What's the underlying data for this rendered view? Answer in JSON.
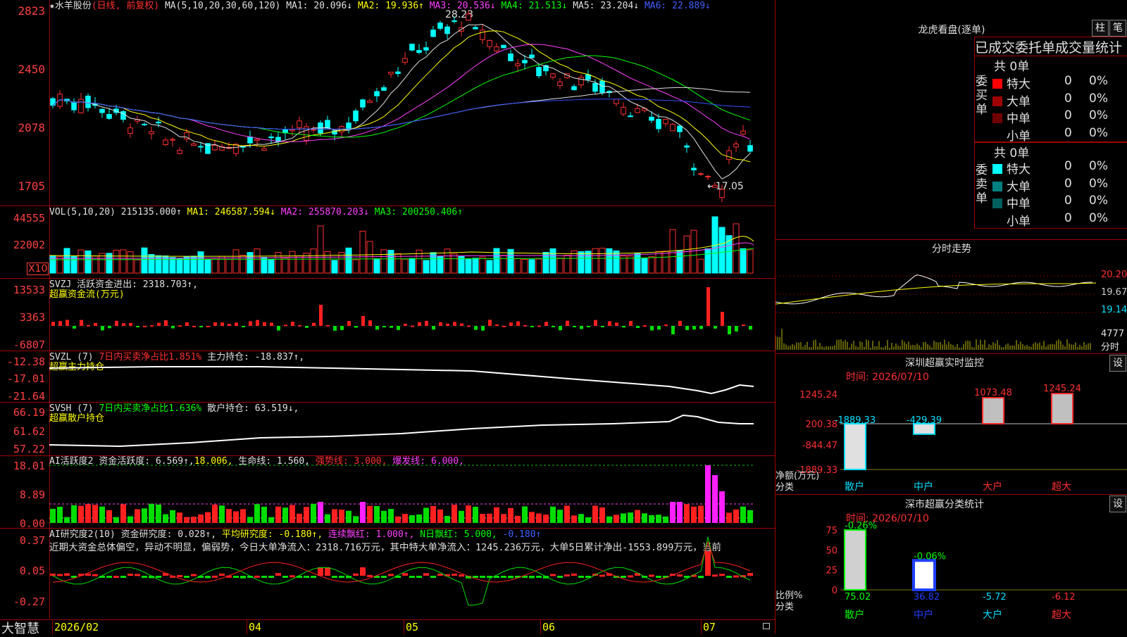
{
  "stock": {
    "star": "★",
    "name": "水羊股份",
    "mode": "(日线, 前复权)"
  },
  "main": {
    "ma_label": "MA(5,10,20,30,60,120)",
    "ma1": "MA1: 20.096↓",
    "ma2": "MA2: 19.936↑",
    "ma3": "MA3: 20.536↓",
    "ma4": "MA4: 21.513↓",
    "ma5": "MA5: 23.204↓",
    "ma6": "MA6: 22.889↓",
    "y_ticks": [
      "2823",
      "2450",
      "2078",
      "1705"
    ],
    "high_label": "28.23",
    "low_label": "←17.05"
  },
  "vol": {
    "label": "VOL(5,10,20)",
    "v": "215135.000↑",
    "ma1": "MA1: 246587.594↓",
    "ma2": "MA2: 255870.203↓",
    "ma3": "MA3: 200250.406↑",
    "y_ticks": [
      "44555",
      "22002"
    ],
    "unit": "X10"
  },
  "svzj": {
    "label1": "SVZJ  活跃资金进出: 2318.703↑,",
    "label2": "超赢资金流(万元)",
    "y_ticks": [
      "13533",
      "3363",
      "-6807"
    ]
  },
  "svzl": {
    "label1a": "SVZL (7)",
    "label1b": "7日内买卖净占比1.851%",
    "label1c": "主力持仓: -18.837↑,",
    "label2": "超赢主力持仓",
    "y_ticks": [
      "-12.38",
      "-17.01",
      "-21.64"
    ]
  },
  "svsh": {
    "label1a": "SVSH (7)",
    "label1b": "7日内买卖净占比1.636%",
    "label1c": "散户持仓: 63.519↓,",
    "label2": "超赢散户持仓",
    "y_ticks": [
      "66.19",
      "61.62",
      "57.22"
    ]
  },
  "ai2": {
    "a": "AI活跃度2",
    "b": "资金活跃度: 6.569↑,",
    "c": "18.006,",
    "d": "生命线: 1.560,",
    "e": "强势线: 3.000,",
    "f": "爆发线: 6.000,",
    "y_ticks": [
      "18.01",
      "8.89",
      "0.00"
    ]
  },
  "ai_r": {
    "a": "AI研究度2(10)",
    "b": "资金研究度: 0.028↑,",
    "c": "平均研究度: -0.180↑,",
    "d": "连续飘红: 1.000↑,",
    "e": "N日飘红: 5.000,",
    "f": "-0.180↑",
    "text": "近期大资金总体偏空，异动不明显，偏弱势，今日大单净流入：2318.716万元，其中特大单净流入：1245.236万元，大单5日累计净出-1553.899万元，当前",
    "y_ticks": [
      "0.37",
      "0.05",
      "-0.27"
    ]
  },
  "dates": [
    "2026/02",
    "04",
    "05",
    "06",
    "07"
  ],
  "brand": "大智慧",
  "right": {
    "lhb_title": "龙虎看盘(逐单)",
    "btn_zhu": "柱",
    "btn_bi": "笔",
    "headers": [
      "已成交",
      "委托单",
      "成交量统计"
    ],
    "buy_side": "委买单",
    "sell_side": "委卖单",
    "buy_total": "共 0单",
    "sell_total": "共 0单",
    "buy_rows": [
      {
        "label": "特大",
        "n": "0",
        "p": "0%",
        "color": "#ff0000"
      },
      {
        "label": "大单",
        "n": "0",
        "p": "0%",
        "color": "#a00000"
      },
      {
        "label": "中单",
        "n": "0",
        "p": "0%",
        "color": "#700000"
      },
      {
        "label": "小单",
        "n": "0",
        "p": "0%",
        "color": ""
      }
    ],
    "sell_rows": [
      {
        "label": "特大",
        "n": "0",
        "p": "0%",
        "color": "#00ffff"
      },
      {
        "label": "大单",
        "n": "0",
        "p": "0%",
        "color": "#008080"
      },
      {
        "label": "中单",
        "n": "0",
        "p": "0%",
        "color": "#006060"
      },
      {
        "label": "小单",
        "n": "0",
        "p": "0%",
        "color": ""
      }
    ],
    "fs_title": "分时走势",
    "fs_ticks": [
      "20.20",
      "19.67",
      "19.14",
      "4777",
      "分时"
    ],
    "sz_title": "深圳超赢实时监控",
    "sz_set": "设",
    "sz_time": "时间: 2026/07/10",
    "sz_ticks": [
      "1245.24",
      "200.38",
      "-844.47",
      "-1889.33"
    ],
    "sz_vals": [
      "-1889.33",
      "-429.39",
      "1073.48",
      "1245.24"
    ],
    "sz_cats": [
      "散户",
      "中户",
      "大户",
      "超大"
    ],
    "sz_unit": "净额(万元)",
    "sz_cat": "分类",
    "fl_title": "深市超赢分类统计",
    "fl_set": "设",
    "fl_time": "时间: 2026/07/10",
    "fl_ticks": [
      "75",
      "50",
      "25",
      "0"
    ],
    "fl_top": [
      "-0.26%",
      "-0.06%"
    ],
    "fl_vals": [
      "75.02",
      "36.82",
      "-5.72",
      "-6.12"
    ],
    "fl_cats": [
      "散户",
      "中户",
      "大户",
      "超大"
    ],
    "fl_unit": "比例%",
    "fl_cat": "分类"
  },
  "chart_data": {
    "type": "candlestick",
    "y_range": [
      17.05,
      28.23
    ],
    "high": 28.23,
    "low": 17.05,
    "x_labels": [
      "2026/02",
      "04",
      "05",
      "06",
      "07"
    ]
  }
}
